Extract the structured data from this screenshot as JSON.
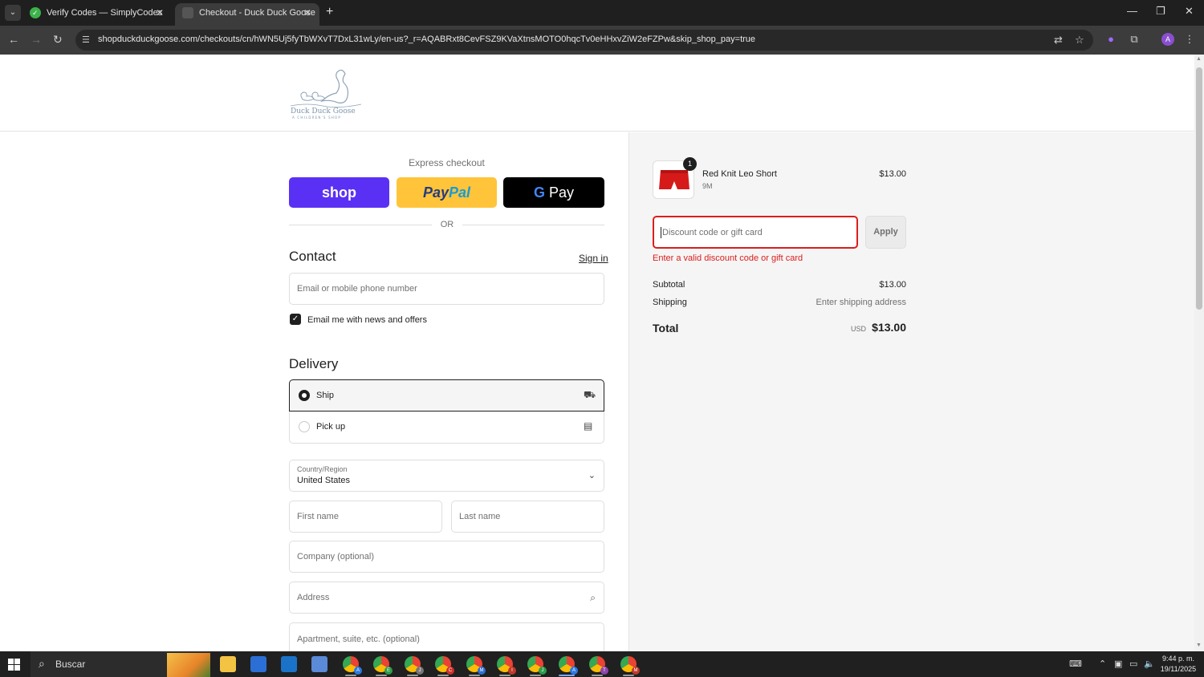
{
  "browser": {
    "tabs": [
      {
        "title": "Verify Codes — SimplyCodes"
      },
      {
        "title": "Checkout - Duck Duck Goose"
      }
    ],
    "url": "shopduckduckgoose.com/checkouts/cn/hWN5Uj5fyTbWXvT7DxL31wLy/en-us?_r=AQABRxt8CevFSZ9KVaXtnsMOTO0hqcTv0eHHxvZiW2eFZPw&skip_shop_pay=true",
    "profile_initial": "A"
  },
  "brand": {
    "logo_text": "Duck Duck Goose",
    "logo_subtext": "A CHILDREN'S SHOP"
  },
  "express": {
    "label": "Express checkout",
    "shop_label": "shop",
    "paypal_label_1": "Pay",
    "paypal_label_2": "Pal",
    "gpay_label": "Pay",
    "or_label": "OR"
  },
  "contact": {
    "heading": "Contact",
    "sign_in": "Sign in",
    "email_placeholder": "Email or mobile phone number",
    "newsletter_label": "Email me with news and offers",
    "newsletter_checked": true
  },
  "delivery": {
    "heading": "Delivery",
    "options": [
      {
        "label": "Ship",
        "selected": true,
        "icon": "truck-icon"
      },
      {
        "label": "Pick up",
        "selected": false,
        "icon": "store-icon"
      }
    ],
    "country_label": "Country/Region",
    "country_value": "United States",
    "first_name_placeholder": "First name",
    "last_name_placeholder": "Last name",
    "company_placeholder": "Company (optional)",
    "address_placeholder": "Address",
    "apartment_placeholder": "Apartment, suite, etc. (optional)"
  },
  "summary": {
    "item": {
      "quantity": "1",
      "name": "Red Knit Leo Short",
      "variant": "9M",
      "price": "$13.00"
    },
    "discount_placeholder": "Discount code or gift card",
    "apply_label": "Apply",
    "error": "Enter a valid discount code or gift card",
    "subtotal_label": "Subtotal",
    "subtotal_value": "$13.00",
    "shipping_label": "Shipping",
    "shipping_value": "Enter shipping address",
    "total_label": "Total",
    "total_currency": "USD",
    "total_value": "$13.00"
  },
  "taskbar": {
    "search_placeholder": "Buscar",
    "time": "9:44 p. m.",
    "date": "19/11/2025"
  },
  "colors": {
    "shop_pay": "#5a31f4",
    "paypal": "#ffc439",
    "error": "#dd1d1d"
  }
}
